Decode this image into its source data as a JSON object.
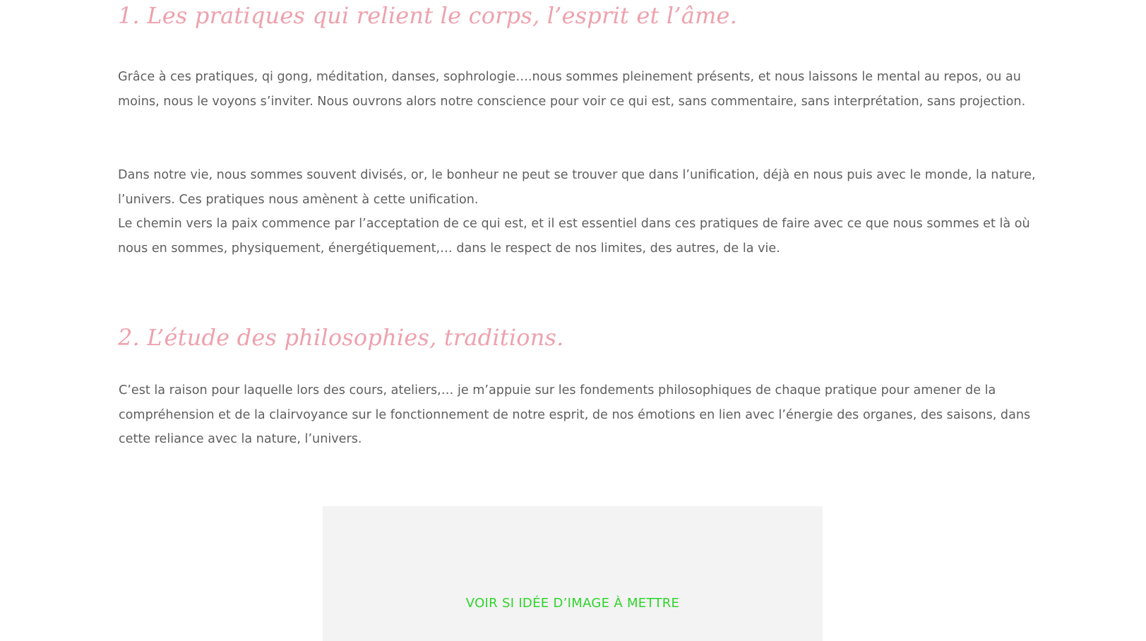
{
  "section1": {
    "title": "1. Les pratiques qui relient le corps, l’esprit et l’âme.",
    "paragraph1": "Grâce à ces pratiques, qi gong, méditation, danses, sophrologie….nous sommes pleinement présents, et nous laissons le mental au repos, ou au moins, nous le voyons s’inviter. Nous ouvrons alors notre conscience pour voir ce qui est, sans commentaire, sans interprétation, sans projection.",
    "paragraph2": "Dans notre vie, nous sommes souvent divisés, or, le bonheur ne peut se trouver que dans l’unification, déjà en nous puis avec le monde, la nature, l’univers. Ces pratiques nous amènent à cette unification.",
    "paragraph3": "Le chemin vers la paix commence par l’acceptation de ce qui est, et il est essentiel dans ces pratiques de faire avec ce que nous sommes et là où nous en sommes, physiquement, énergétiquement,… dans le respect de nos limites, des autres, de la vie."
  },
  "section2": {
    "title": "2. L’étude des philosophies, traditions.",
    "paragraph1": "C’est la raison pour laquelle lors des cours, ateliers,… je m’appuie sur les fondements philosophiques de chaque pratique pour amener de la compréhension et de la clairvoyance sur le fonctionnement de notre esprit, de nos émotions en lien avec l’énergie des organes, des saisons, dans cette reliance avec la nature, l’univers."
  },
  "image_placeholder": {
    "text": "VOIR SI IDÉE D’IMAGE À METTRE"
  },
  "colors": {
    "title": "#eea1ad",
    "body_text": "#5f5f5f",
    "placeholder_bg": "#f3f3f3",
    "placeholder_text": "#2fd42b"
  }
}
